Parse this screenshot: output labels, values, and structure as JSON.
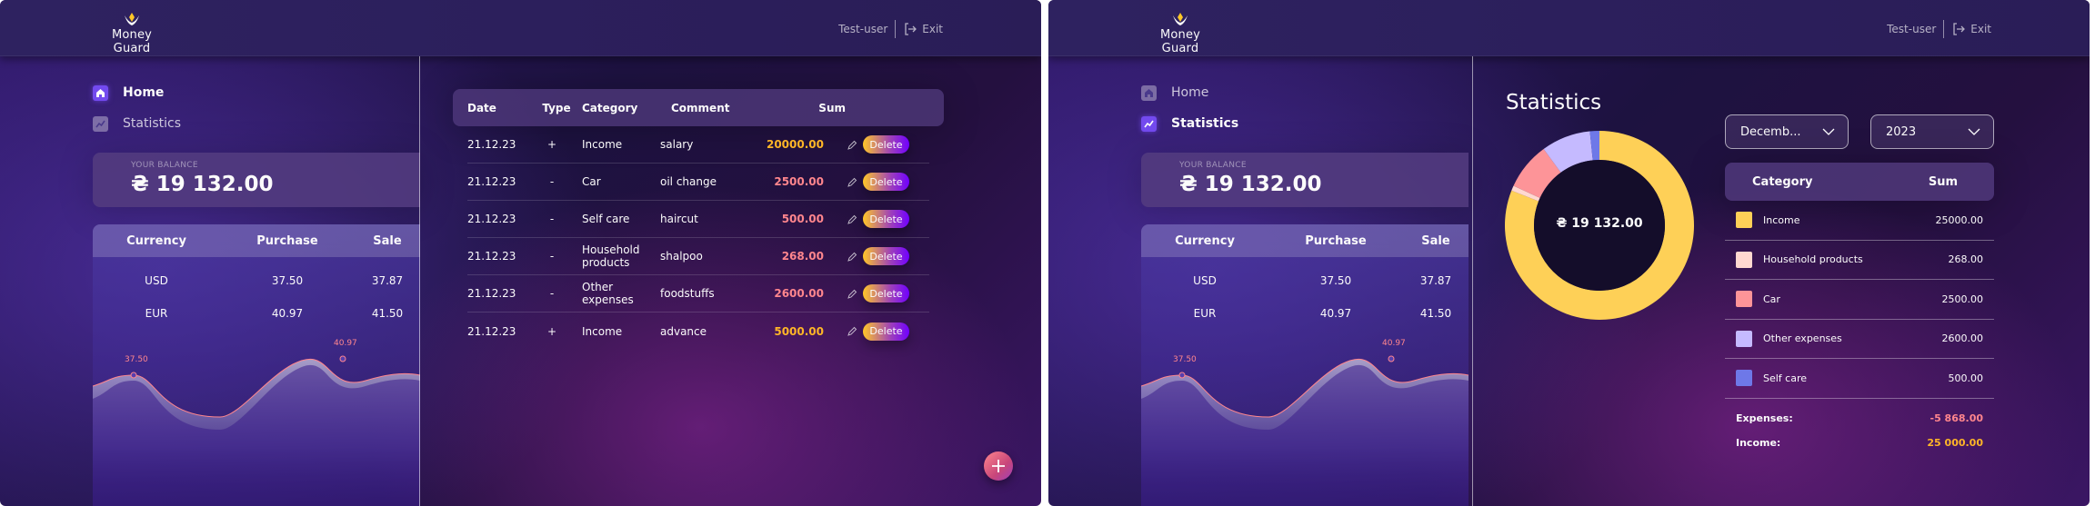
{
  "app": {
    "name": "Money Guard"
  },
  "header": {
    "username": "Test-user",
    "exit_label": "Exit"
  },
  "nav": {
    "home": "Home",
    "statistics": "Statistics"
  },
  "balance": {
    "label": "YOUR BALANCE",
    "value": "₴ 19 132.00"
  },
  "currency": {
    "headers": [
      "Currency",
      "Purchase",
      "Sale"
    ],
    "rows": [
      {
        "currency": "USD",
        "purchase": "37.50",
        "sale": "37.87"
      },
      {
        "currency": "EUR",
        "purchase": "40.97",
        "sale": "41.50"
      }
    ],
    "chart_labels": {
      "usd": "37.50",
      "eur": "40.97"
    }
  },
  "transactions": {
    "headers": {
      "date": "Date",
      "type": "Type",
      "category": "Category",
      "comment": "Comment",
      "sum": "Sum"
    },
    "delete_label": "Delete",
    "rows": [
      {
        "date": "21.12.23",
        "type": "+",
        "category": "Income",
        "comment": "salary",
        "sum": "20000.00",
        "kind": "pos"
      },
      {
        "date": "21.12.23",
        "type": "-",
        "category": "Car",
        "comment": "oil change",
        "sum": "2500.00",
        "kind": "neg"
      },
      {
        "date": "21.12.23",
        "type": "-",
        "category": "Self care",
        "comment": "haircut",
        "sum": "500.00",
        "kind": "neg"
      },
      {
        "date": "21.12.23",
        "type": "-",
        "category": "Household products",
        "comment": "shalpoo",
        "sum": "268.00",
        "kind": "neg"
      },
      {
        "date": "21.12.23",
        "type": "-",
        "category": "Other expenses",
        "comment": "foodstuffs",
        "sum": "2600.00",
        "kind": "neg"
      },
      {
        "date": "21.12.23",
        "type": "+",
        "category": "Income",
        "comment": "advance",
        "sum": "5000.00",
        "kind": "pos"
      }
    ]
  },
  "statistics": {
    "title": "Statistics",
    "month": "Decemb...",
    "year": "2023",
    "balance_center": "₴ 19 132.00",
    "table_headers": {
      "category": "Category",
      "sum": "Sum"
    },
    "categories": [
      {
        "name": "Income",
        "sum": "25000.00",
        "color": "#fed057"
      },
      {
        "name": "Household products",
        "sum": "268.00",
        "color": "#ffd8d0"
      },
      {
        "name": "Car",
        "sum": "2500.00",
        "color": "#fd9498"
      },
      {
        "name": "Other expenses",
        "sum": "2600.00",
        "color": "#c5baff"
      },
      {
        "name": "Self care",
        "sum": "500.00",
        "color": "#6e78e8"
      }
    ],
    "expenses_label": "Expenses:",
    "expenses_value": "-5 868.00",
    "income_label": "Income:",
    "income_value": "25 000.00",
    "donut_values": [
      25000,
      268,
      2500,
      2600,
      500
    ]
  },
  "colors": {
    "accent": "#734aef",
    "income": "#ffb627",
    "expense": "#ff868d"
  }
}
